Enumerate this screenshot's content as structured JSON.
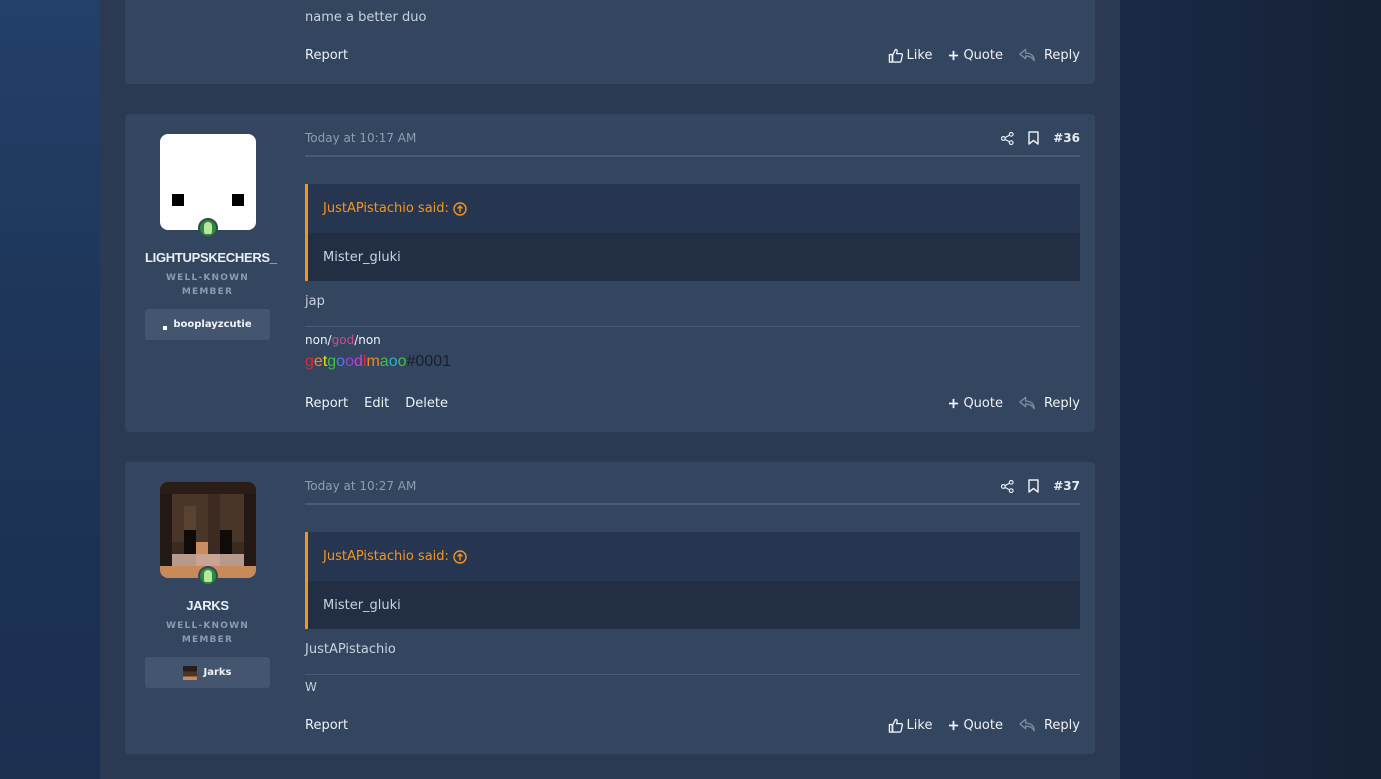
{
  "prev_post": {
    "message": "name a better duo",
    "actions_left": [
      "Report"
    ],
    "like_label": "Like",
    "quote_label": "Quote",
    "reply_label": "Reply"
  },
  "post36": {
    "date": "Today at 10:17 AM",
    "number": "#36",
    "user": {
      "name": "LIGHTUPSKECHERS_",
      "title": "WELL-KNOWN MEMBER",
      "banner": "booplayzcutie"
    },
    "quote_author": "JustAPistachio said:",
    "quote_text": "Mister_gluki",
    "message": "jap",
    "signature": {
      "line1_parts": [
        "non/",
        "god",
        "/non"
      ],
      "line2_letters": [
        "g",
        "e",
        "t",
        "g",
        "o",
        "o",
        "d",
        "l",
        "m",
        "a",
        "o",
        "o"
      ],
      "line2_colors": [
        "#e3253a",
        "#f18a1f",
        "#e6e21a",
        "#3cc43c",
        "#4a7cf0",
        "#9c3de6",
        "#d43bd0",
        "#e3253a",
        "#f18a1f",
        "#3cc43c",
        "#26b0d6",
        "#3cc43c"
      ],
      "line2_suffix": "#0001",
      "god_color": "#d24a8a"
    },
    "actions_left": [
      "Report",
      "Edit",
      "Delete"
    ],
    "quote_label": "Quote",
    "reply_label": "Reply"
  },
  "post37": {
    "date": "Today at 10:27 AM",
    "number": "#37",
    "user": {
      "name": "JARKS",
      "title": "WELL-KNOWN MEMBER",
      "banner": "Jarks"
    },
    "quote_author": "JustAPistachio said:",
    "quote_text": "Mister_gluki",
    "message": "JustAPistachio",
    "signature": "W",
    "actions_left": [
      "Report"
    ],
    "like_label": "Like",
    "quote_label": "Quote",
    "reply_label": "Reply"
  },
  "colors": {
    "accent": "#f4961e",
    "online": "#2f8a35",
    "post_bg": "#34455f"
  }
}
